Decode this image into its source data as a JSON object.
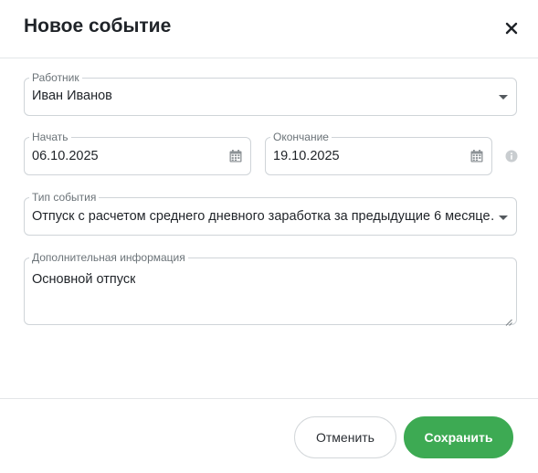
{
  "dialog": {
    "title": "Новое событие",
    "close_icon": "close-icon"
  },
  "form": {
    "employee": {
      "label": "Работник",
      "value": "Иван Иванов"
    },
    "start": {
      "label": "Начать",
      "value": "06.10.2025"
    },
    "end": {
      "label": "Окончание",
      "value": "19.10.2025"
    },
    "event_type": {
      "label": "Тип события",
      "value": "Отпуск с расчетом среднего дневного заработка за предыдущие 6 месяце…"
    },
    "extra_info": {
      "label": "Дополнительная информация",
      "value": "Основной отпуск"
    }
  },
  "footer": {
    "cancel_label": "Отменить",
    "save_label": "Сохранить"
  },
  "colors": {
    "accent": "#3daa53",
    "border": "#cfd4d8"
  }
}
